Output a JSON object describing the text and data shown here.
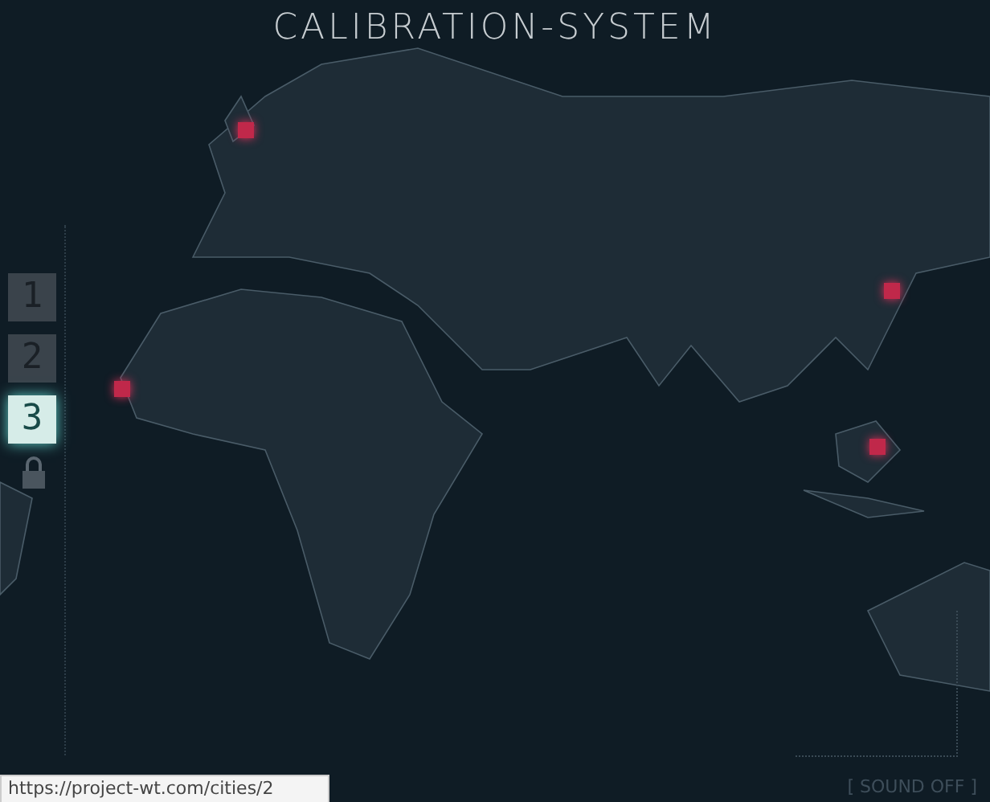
{
  "header": {
    "title": "CALIBRATION-SYSTEM"
  },
  "levels": [
    {
      "label": "1",
      "selected": false
    },
    {
      "label": "2",
      "selected": false
    },
    {
      "label": "3",
      "selected": true
    }
  ],
  "lock": {
    "locked": true
  },
  "sound_toggle": {
    "label": "[ SOUND OFF ]"
  },
  "status_bar": {
    "url": "https://project-wt.com/cities/2"
  }
}
